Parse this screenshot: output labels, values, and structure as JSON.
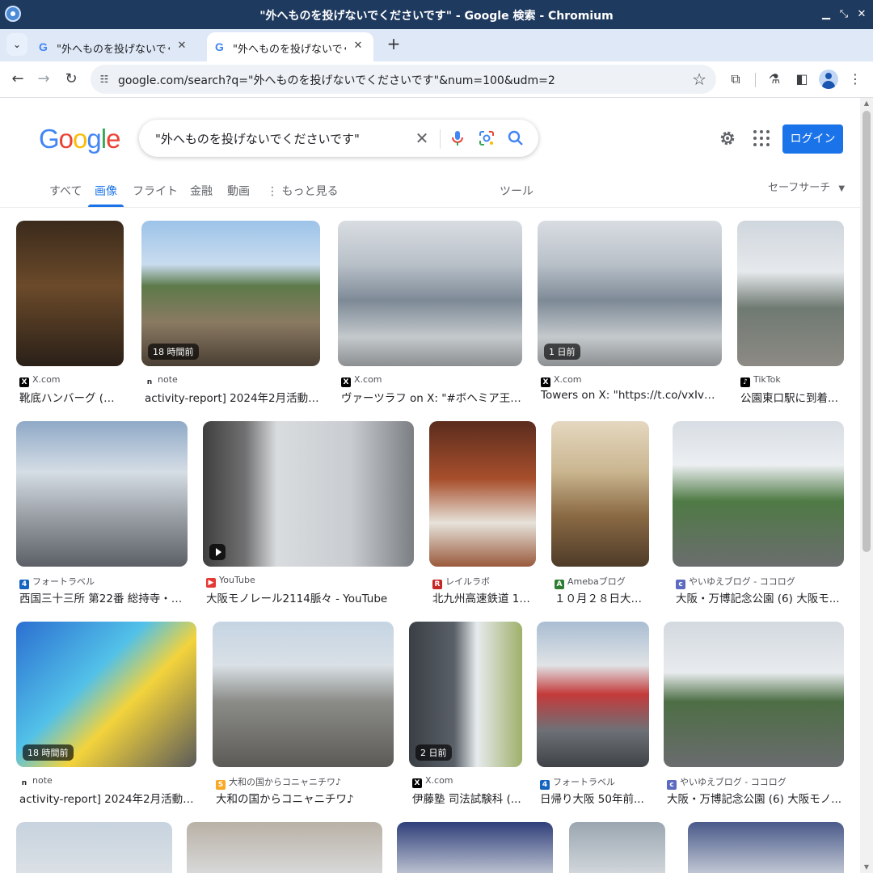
{
  "window": {
    "title": "\"外へものを投げないでくださいです\" - Google 検索 - Chromium"
  },
  "tabs": [
    {
      "label": "\"外へものを投げないでくださいです\""
    },
    {
      "label": "\"外へものを投げないでくださいです\""
    }
  ],
  "toolbar": {
    "url": "google.com/search?q=\"外へものを投げないでくださいです\"&num=100&udm=2"
  },
  "google": {
    "logo_letters": [
      "G",
      "o",
      "o",
      "g",
      "l",
      "e"
    ],
    "query": "\"外へものを投げないでくださいです\"",
    "login_label": "ログイン",
    "nav": [
      "すべて",
      "画像",
      "フライト",
      "金融",
      "動画",
      "もっと見る"
    ],
    "tools_label": "ツール",
    "safesearch_label": "セーフサーチ"
  },
  "colors": {
    "accent": "#1a73e8",
    "titlebar": "#1f3a5f",
    "tabstrip": "#dee8f7"
  },
  "results": [
    {
      "source": "X.com",
      "fav": "X",
      "fav_color": "#000000",
      "caption": "靴底ハンバーグ (@...",
      "badge": "",
      "scene": "night-sign"
    },
    {
      "source": "note",
      "fav": "n",
      "fav_color": "#ffffff",
      "caption": "activity-report] 2024年2月活動報告...",
      "badge": "18 時間前",
      "scene": "fence-park"
    },
    {
      "source": "X.com",
      "fav": "X",
      "fav_color": "#000000",
      "caption": "ヴァーツラフ on X: \"#ボヘミア王漫...",
      "badge": "",
      "scene": "monorail-station"
    },
    {
      "source": "X.com",
      "fav": "X",
      "fav_color": "#000000",
      "caption": "Towers on X: \"https://t.co/vxIvW96...",
      "badge": "1 日前",
      "scene": "monorail-station"
    },
    {
      "source": "TikTok",
      "fav": "♪",
      "fav_color": "#000000",
      "caption": "公園東口駅に到着...",
      "badge": "",
      "scene": "cloudy-track"
    },
    {
      "source": "フォートラベル",
      "fav": "4",
      "fav_color": "#1565c0",
      "caption": "西国三十三所 第22番 総持寺・第...",
      "badge": "",
      "scene": "monorail-blue"
    },
    {
      "source": "YouTube",
      "fav": "▶",
      "fav_color": "#e53935",
      "caption": "大阪モノレール2114脈々 - YouTube",
      "badge": "",
      "scene": "wall-fence",
      "play": true
    },
    {
      "source": "レイルラボ",
      "fav": "R",
      "fav_color": "#c62828",
      "caption": "北九州高速鉄道 14...",
      "badge": "",
      "scene": "door-sign"
    },
    {
      "source": "Amebaブログ",
      "fav": "A",
      "fav_color": "#2e7d32",
      "caption": "１０月２８日大阪...",
      "badge": "",
      "scene": "sunset-fence"
    },
    {
      "source": "やいゆえブログ - ココログ",
      "fav": "c",
      "fav_color": "#5c6bc0",
      "caption": "大阪・万博記念公園 (6) 大阪モ...",
      "badge": "",
      "scene": "park-monorail"
    },
    {
      "source": "note",
      "fav": "n",
      "fav_color": "#ffffff",
      "caption": "activity-report] 2024年2月活動報告...",
      "badge": "18 時間前",
      "scene": "melonbooks"
    },
    {
      "source": "大和の国からコニャニチワ♪",
      "fav": "S",
      "fav_color": "#f9a825",
      "caption": "大和の国からコニャニチワ♪",
      "badge": "",
      "scene": "city-tracks"
    },
    {
      "source": "X.com",
      "fav": "X",
      "fav_color": "#000000",
      "caption": "伊藤塾 司法試験科 (...",
      "badge": "2 日前",
      "scene": "selfie"
    },
    {
      "source": "フォートラベル",
      "fav": "4",
      "fav_color": "#1565c0",
      "caption": "日帰り大阪 50年前...",
      "badge": "",
      "scene": "monorail-red"
    },
    {
      "source": "やいゆえブログ - ココログ",
      "fav": "c",
      "fav_color": "#5c6bc0",
      "caption": "大阪・万博記念公園 (6) 大阪モノ...",
      "badge": "",
      "scene": "park-wide"
    }
  ]
}
